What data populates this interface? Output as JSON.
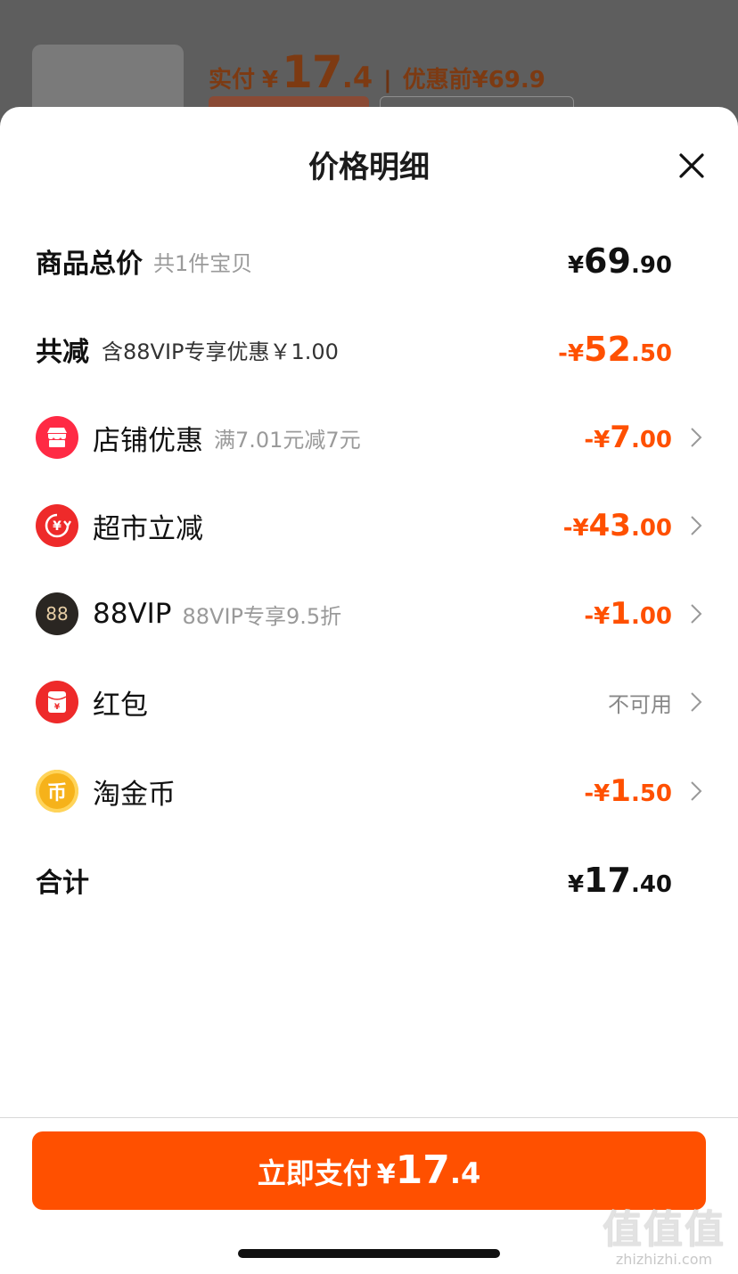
{
  "background": {
    "paid_label": "实付",
    "paid_yen": "¥",
    "paid_int": "17",
    "paid_dec": ".4",
    "separator": "|",
    "before_discount": "优惠前¥69.9"
  },
  "sheet": {
    "title": "价格明细"
  },
  "total_price": {
    "label": "商品总价",
    "sub": "共1件宝贝",
    "yen": "¥",
    "int": "69",
    "dec": ".90"
  },
  "total_discount": {
    "label": "共减",
    "sub": "含88VIP专享优惠￥1.00",
    "prefix": "-¥",
    "int": "52",
    "dec": ".50"
  },
  "items": [
    {
      "icon": "store-icon",
      "label": "店铺优惠",
      "sub": "满7.01元减7元",
      "prefix": "-¥",
      "int": "7",
      "dec": ".00"
    },
    {
      "icon": "supermarket-discount-icon",
      "label": "超市立减",
      "sub": "",
      "prefix": "-¥",
      "int": "43",
      "dec": ".00"
    },
    {
      "icon": "88vip-icon",
      "icon_text": "88",
      "label": "88VIP",
      "sub": "88VIP专享9.5折",
      "prefix": "-¥",
      "int": "1",
      "dec": ".00"
    },
    {
      "icon": "red-packet-icon",
      "label": "红包",
      "sub": "",
      "status": "不可用"
    },
    {
      "icon": "taojin-coin-icon",
      "icon_text": "币",
      "label": "淘金币",
      "sub": "",
      "prefix": "-¥",
      "int": "1",
      "dec": ".50"
    }
  ],
  "sum": {
    "label": "合计",
    "yen": "¥",
    "int": "17",
    "dec": ".40"
  },
  "pay_button": {
    "label": "立即支付",
    "yen": "¥",
    "int": "17",
    "dec": ".4"
  },
  "watermark": {
    "big": "值值值",
    "small": "zhizhizhi.com"
  },
  "colors": {
    "accent": "#ff5000",
    "store_icon": "#ff2a44",
    "vip_icon": "#2a2622",
    "coin_icon": "#f6b21a"
  }
}
